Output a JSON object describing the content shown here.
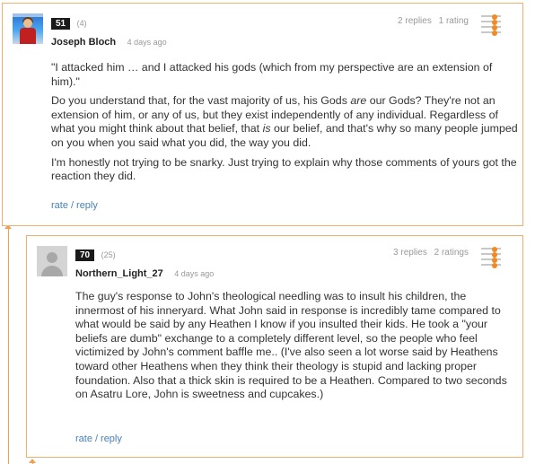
{
  "comments": [
    {
      "score": "51",
      "votes": "(4)",
      "author": "Joseph Bloch",
      "time": "4 days ago",
      "replies": "2 replies",
      "ratings": "1 rating",
      "paragraphs": [
        "\"I attacked him … and I attacked his gods (which from my perspective are an extension of him).\"",
        "Do you understand that, for the vast majority of us, his Gods are our Gods? They're not an extension of him, or any of us, but they exist independently of any individual. Regardless of what you might think about that belief, that is our belief, and that's why so many people jumped on you when you said what you did, the way you did.",
        "I'm honestly not trying to be snarky. Just trying to explain why those comments of yours got the reaction they did."
      ],
      "emph": [
        "are",
        "is"
      ],
      "rate_label": "rate",
      "reply_label": "reply",
      "separator": "/"
    },
    {
      "score": "70",
      "votes": "(25)",
      "author": "Northern_Light_27",
      "time": "4 days ago",
      "replies": "3 replies",
      "ratings": "2 ratings",
      "paragraphs": [
        "The guy's response to John's theological needling was to insult his children, the innermost of his inneryard. What John said in response is incredibly tame compared to what would be said by any Heathen I know if you insulted their kids. He took a \"your beliefs are dumb\" exchange to a completely different level, so the people who feel victimized by John's comment baffle me.. (I've also seen a lot worse said by Heathens toward other Heathens when they think their theology is stupid and lacking proper foundation. Also that a thick skin is required to be a Heathen. Compared to two seconds on Asatru Lore, John is sweetness and cupcakes.)"
      ],
      "rate_label": "rate",
      "reply_label": "reply",
      "separator": "/"
    }
  ],
  "colors": {
    "accent": "#f08a24",
    "border": "#f0b070",
    "link": "#4a7fb8",
    "score_bg": "#1a1a1a"
  },
  "icons": {
    "rating_widget": "rating-meter-icon",
    "avatar_default": "default-avatar-icon",
    "thread_arrow": "arrow-up-icon"
  }
}
